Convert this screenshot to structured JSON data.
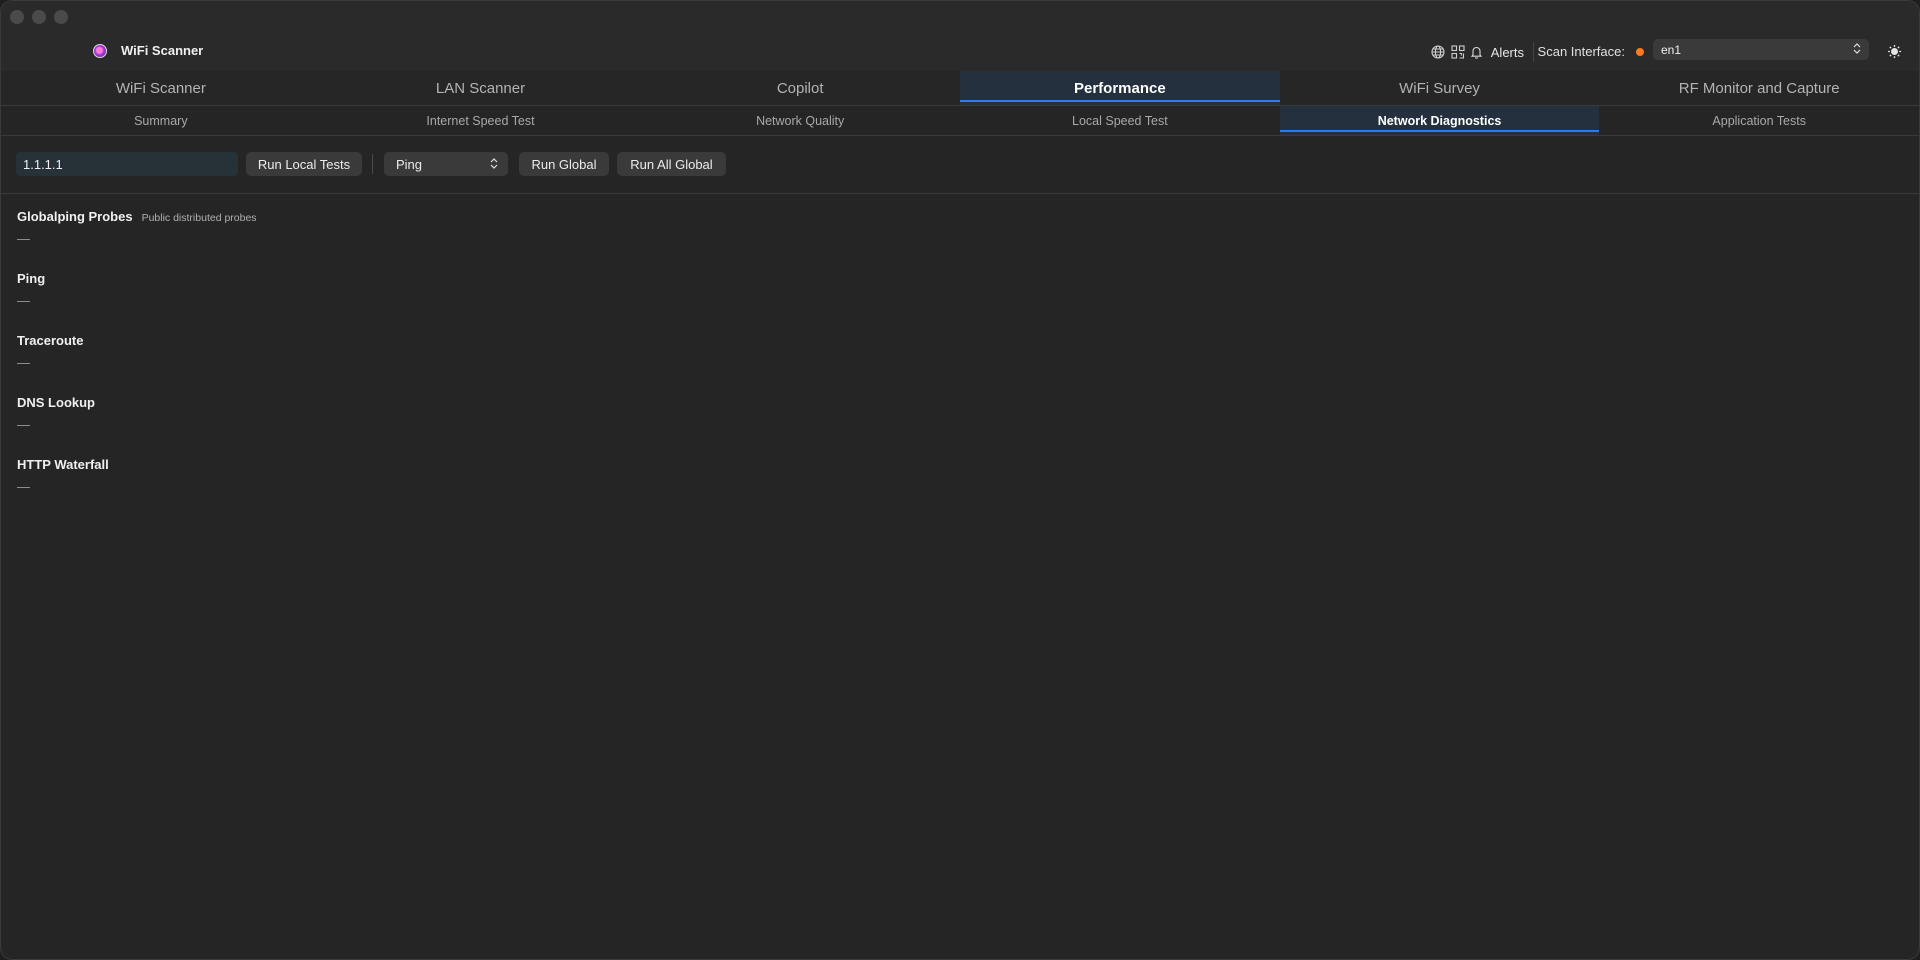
{
  "app": {
    "title": "WiFi Scanner"
  },
  "toolbar": {
    "alerts_label": "Alerts",
    "scan_interface_label": "Scan Interface:",
    "interface_value": "en1",
    "status_color": "#ff7a1a"
  },
  "main_tabs": [
    {
      "label": "WiFi Scanner"
    },
    {
      "label": "LAN Scanner"
    },
    {
      "label": "Copilot"
    },
    {
      "label": "Performance",
      "active": true
    },
    {
      "label": "WiFi Survey"
    },
    {
      "label": "RF Monitor and Capture"
    }
  ],
  "sub_tabs": [
    {
      "label": "Summary"
    },
    {
      "label": "Internet Speed Test"
    },
    {
      "label": "Network Quality"
    },
    {
      "label": "Local Speed Test"
    },
    {
      "label": "Network Diagnostics",
      "active": true
    },
    {
      "label": "Application Tests"
    }
  ],
  "controls": {
    "target_value": "1.1.1.1",
    "run_local_label": "Run Local Tests",
    "test_type_value": "Ping",
    "run_global_label": "Run Global",
    "run_all_global_label": "Run All Global"
  },
  "sections": [
    {
      "title": "Globalping Probes",
      "subtitle": "Public distributed probes",
      "value": "—"
    },
    {
      "title": "Ping",
      "value": "—"
    },
    {
      "title": "Traceroute",
      "value": "—"
    },
    {
      "title": "DNS Lookup",
      "value": "—"
    },
    {
      "title": "HTTP Waterfall",
      "value": "—"
    }
  ],
  "colors": {
    "accent": "#2e7bf0",
    "active_tab_bg": "#24303d"
  },
  "icons": [
    "globe-icon",
    "qr-code-icon",
    "bell-icon",
    "chevron-updown-icon",
    "sun-icon"
  ]
}
